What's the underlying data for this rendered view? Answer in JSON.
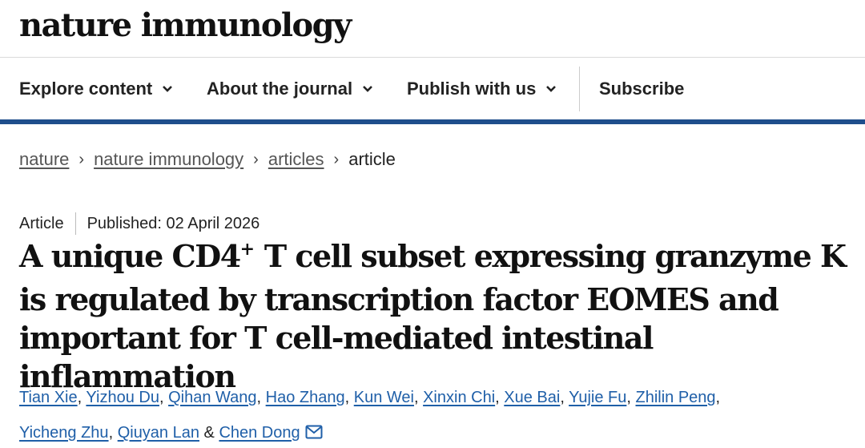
{
  "header": {
    "logo": "nature immunology"
  },
  "nav": {
    "items": [
      {
        "label": "Explore content",
        "dropdown": true
      },
      {
        "label": "About the journal",
        "dropdown": true
      },
      {
        "label": "Publish with us",
        "dropdown": true
      },
      {
        "label": "Subscribe",
        "dropdown": false
      }
    ]
  },
  "breadcrumb": {
    "items": [
      "nature",
      "nature immunology",
      "articles"
    ],
    "current": "article",
    "separator": "›"
  },
  "article": {
    "type": "Article",
    "published": "Published: 02 April 2026",
    "title_part1": "A unique CD4",
    "title_sup": "+",
    "title_part2": " T cell subset expressing granzyme K is regulated by transcription factor EOMES and important for T cell-mediated intestinal inflammation",
    "authors": [
      "Tian Xie",
      "Yizhou Du",
      "Qihan Wang",
      "Hao Zhang",
      "Kun Wei",
      "Xinxin Chi",
      "Xue Bai",
      "Yujie Fu",
      "Zhilin Peng",
      "Yicheng Zhu",
      "Qiuyan Lan",
      "Chen Dong"
    ],
    "author_sep": ", ",
    "author_last_sep": " & ",
    "corresponding_icon": "mail-icon"
  },
  "colors": {
    "accent_rule": "#1f4e8c",
    "link": "#1f5fa8",
    "text": "#222222"
  }
}
